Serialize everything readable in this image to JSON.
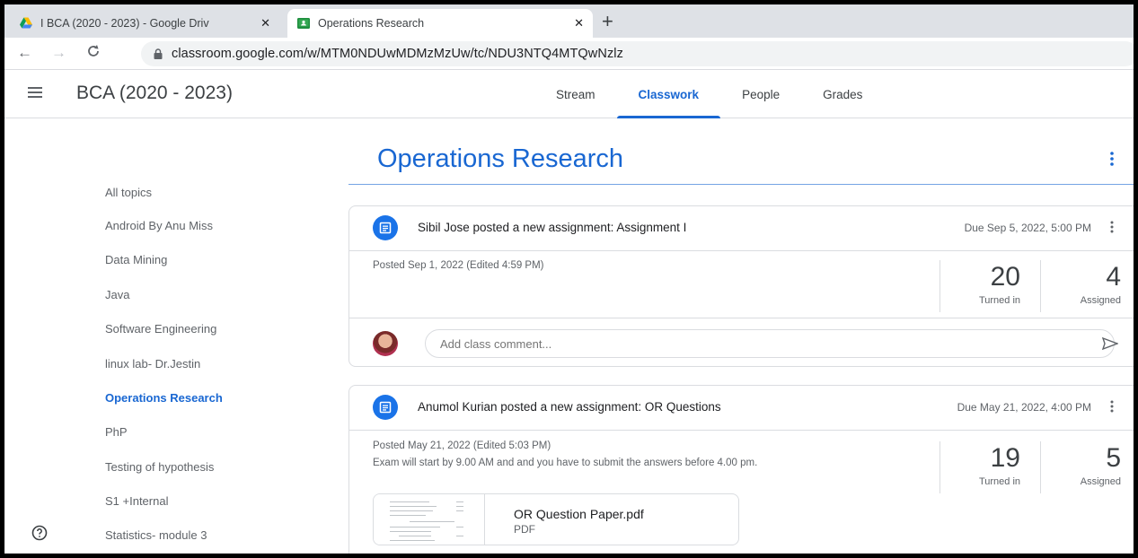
{
  "browser": {
    "tabs": [
      {
        "title": "I BCA (2020 - 2023) - Google Driv",
        "icon": "google-drive-icon"
      },
      {
        "title": "Operations Research",
        "icon": "google-classroom-icon"
      }
    ],
    "url": "classroom.google.com/w/MTM0NDUwMDMzMzUw/tc/NDU3NTQ4MTQwNzlz"
  },
  "header": {
    "class_name": "BCA (2020 - 2023)",
    "nav": [
      "Stream",
      "Classwork",
      "People",
      "Grades"
    ],
    "active_nav": "Classwork"
  },
  "sidebar": {
    "topics": [
      "All topics",
      "Android By Anu Miss",
      "Data Mining",
      "Java",
      "Software Engineering",
      "linux lab- Dr.Jestin",
      "Operations Research",
      "PhP",
      "Testing of hypothesis",
      "S1 +Internal",
      "Statistics- module 3"
    ],
    "active_topic": "Operations Research"
  },
  "main": {
    "topic_title": "Operations Research",
    "assignments": [
      {
        "title": "Sibil Jose posted a new assignment: Assignment I",
        "due": "Due Sep 5, 2022, 5:00 PM",
        "posted": "Posted Sep 1, 2022 (Edited 4:59 PM)",
        "turned_in": "20",
        "turned_in_label": "Turned in",
        "assigned": "4",
        "assigned_label": "Assigned",
        "comment_placeholder": "Add class comment..."
      },
      {
        "title": "Anumol Kurian posted a new assignment: OR Questions",
        "due": "Due May 21, 2022, 4:00 PM",
        "posted": "Posted May 21, 2022 (Edited 5:03 PM)",
        "description": "Exam will start by 9.00 AM and and you have to submit the answers before 4.00 pm.",
        "turned_in": "19",
        "turned_in_label": "Turned in",
        "assigned": "5",
        "assigned_label": "Assigned",
        "attachment": {
          "name": "OR Question Paper.pdf",
          "type": "PDF"
        }
      }
    ]
  },
  "colors": {
    "accent": "#1967d2",
    "assignment_icon": "#1a73e8"
  }
}
